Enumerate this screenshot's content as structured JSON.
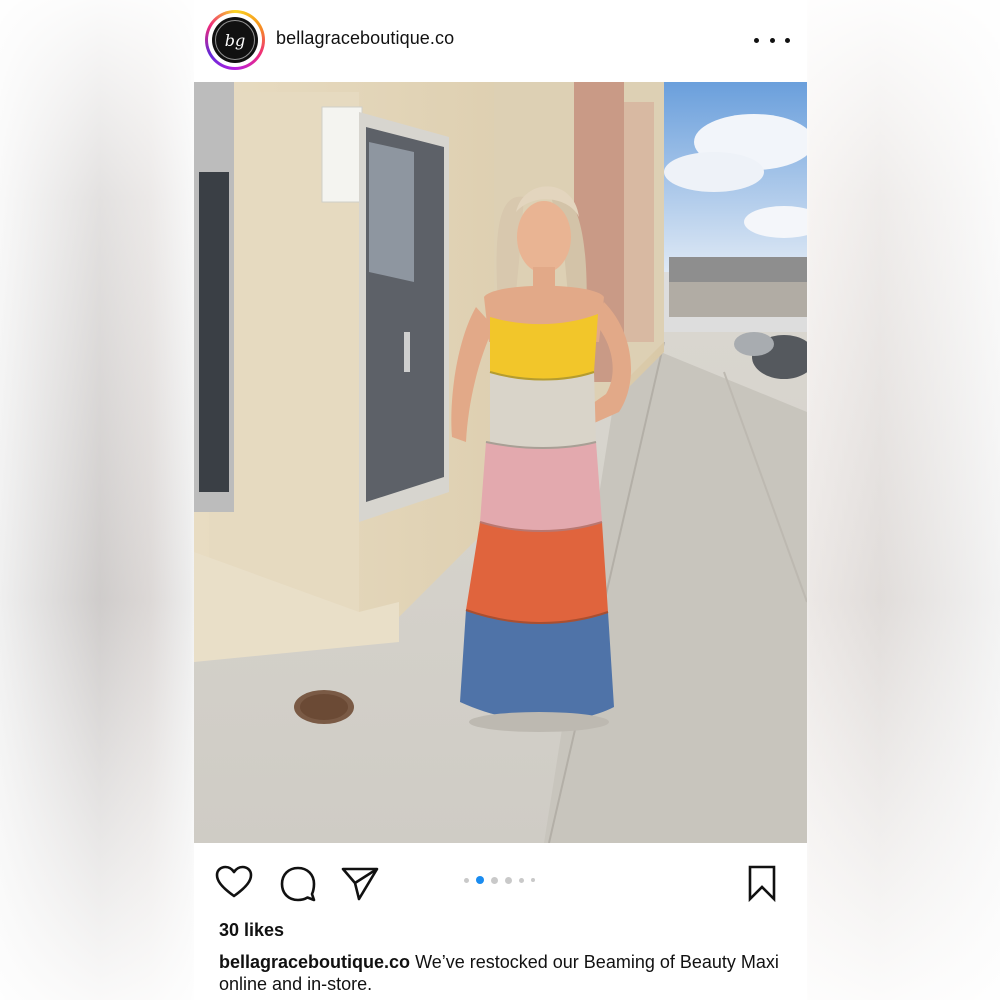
{
  "post": {
    "username": "bellagraceboutique.co",
    "avatar_monogram": "bg",
    "more_icon": "more-horizontal-icon",
    "likes": "30 likes",
    "caption_user": "bellagraceboutique.co",
    "caption_text": "We’ve restocked our Beaming of Beauty Maxi online and in-store.",
    "carousel": {
      "count": 5,
      "active_index": 1
    }
  },
  "photo": {
    "description_icon": "post-photo",
    "dress_colors": [
      "#f2c62a",
      "#d9d4c9",
      "#e3a9ae",
      "#e0643d",
      "#4f73a8"
    ]
  },
  "colors": {
    "carousel_active": "#1a8cf0",
    "text": "#111111"
  }
}
